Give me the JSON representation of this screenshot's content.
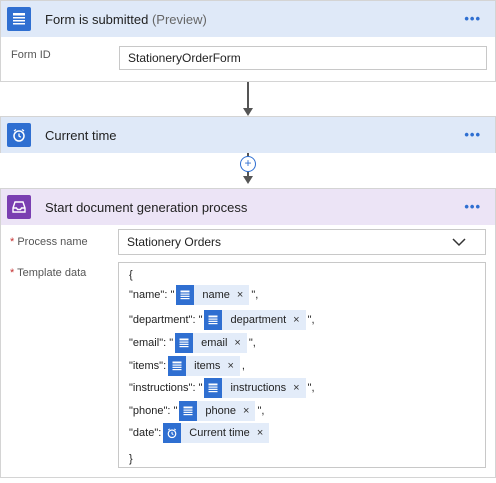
{
  "trigger": {
    "title": "Form is submitted",
    "title_suffix": "(Preview)",
    "more": "•••",
    "form_id_label": "Form ID",
    "form_id_value": "StationeryOrderForm",
    "icon": "form-icon",
    "accent": "#2f6fd1"
  },
  "current_time": {
    "title": "Current time",
    "more": "•••",
    "icon": "alarm-clock-icon",
    "accent": "#2f6fd1"
  },
  "add_step": {
    "label": "+"
  },
  "doc_gen": {
    "title": "Start document generation process",
    "more": "•••",
    "icon": "inbox-tray-icon",
    "accent": "#7a3fb1",
    "header_bg": "#ece4f6",
    "process_name_label": "Process name",
    "process_name_required": "*",
    "process_name_value": "Stationery Orders",
    "template_data_label": "Template data",
    "template_data_required": "*",
    "template_lines": [
      {
        "open": "{"
      },
      {
        "key": "\"name\": \"",
        "token": "name",
        "token_type": "form",
        "tail": "\","
      },
      {
        "key": "\"department\": \"",
        "token": "department",
        "token_type": "form",
        "tail": "\","
      },
      {
        "key": "\"email\": \"",
        "token": "email",
        "token_type": "form",
        "tail": "\","
      },
      {
        "key": "\"items\": ",
        "token": "items",
        "token_type": "form",
        "tail": ","
      },
      {
        "key": "\"instructions\": \"",
        "token": "instructions",
        "token_type": "form",
        "tail": "\","
      },
      {
        "key": "\"phone\": \"",
        "token": "phone",
        "token_type": "form",
        "tail": "\","
      },
      {
        "key": "\"date\": ",
        "token": "Current time",
        "token_type": "clock",
        "tail": ""
      },
      {
        "open": "}"
      }
    ],
    "token_remove": "×"
  },
  "colors": {
    "blue_header": "#dfe9f8",
    "blue_icon": "#2f6fd1",
    "purple_header": "#ece4f6",
    "purple_icon": "#7a3fb1",
    "token_bg": "#e3ecf9"
  }
}
